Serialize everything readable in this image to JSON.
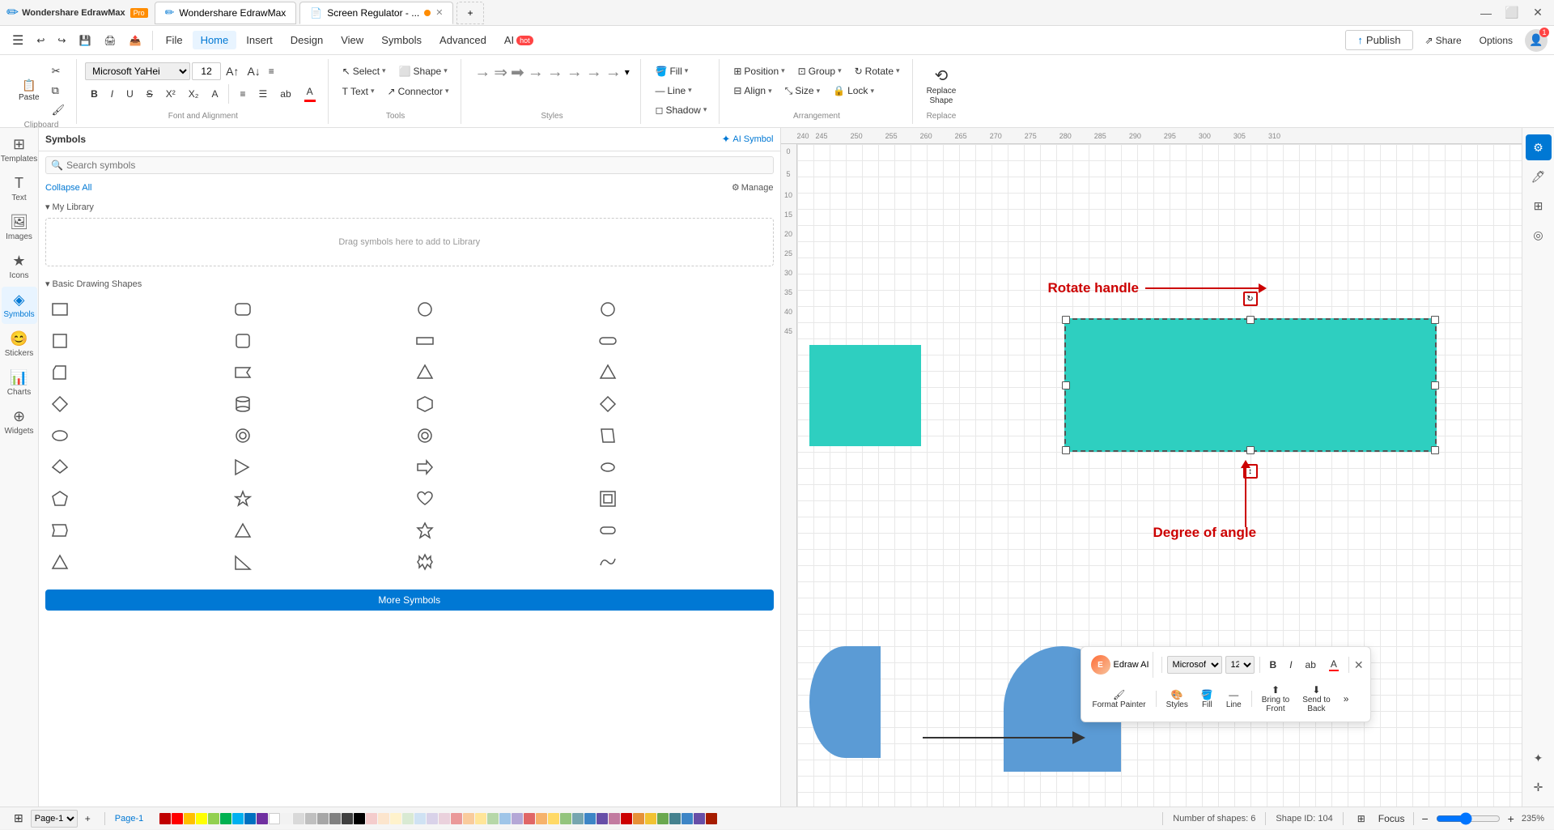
{
  "app": {
    "name": "Wondershare EdrawMax",
    "badge": "Pro"
  },
  "titlebar": {
    "tabs": [
      {
        "label": "Wondershare EdrawMax",
        "active": false
      },
      {
        "label": "Screen Regulator - ...",
        "active": true,
        "dot": true
      }
    ],
    "new_tab": "+",
    "win_controls": [
      "—",
      "⬜",
      "✕"
    ]
  },
  "menubar": {
    "items": [
      {
        "label": "File",
        "id": "file"
      },
      {
        "label": "Home",
        "id": "home",
        "active": true
      },
      {
        "label": "Insert",
        "id": "insert"
      },
      {
        "label": "Design",
        "id": "design"
      },
      {
        "label": "View",
        "id": "view"
      },
      {
        "label": "Symbols",
        "id": "symbols"
      },
      {
        "label": "Advanced",
        "id": "advanced"
      },
      {
        "label": "AI",
        "id": "ai",
        "badge": "hot"
      }
    ],
    "right": {
      "publish": "Publish",
      "share": "Share",
      "options": "Options",
      "notification_count": "1"
    }
  },
  "toolbar": {
    "clipboard": {
      "label": "Clipboard",
      "buttons": [
        "Paste",
        "Cut",
        "Copy",
        "Format Painter"
      ]
    },
    "font": {
      "label": "Font and Alignment",
      "font_name": "Microsoft YaHei",
      "font_size": "12",
      "buttons": [
        "B",
        "I",
        "U",
        "S",
        "X²",
        "X₂",
        "A",
        "≡",
        "☰",
        "ab",
        "A"
      ]
    },
    "tools": {
      "label": "Tools",
      "select": "Select",
      "select_arrow": "▾",
      "shape": "Shape",
      "shape_arrow": "▾",
      "text": "Text",
      "text_arrow": "▾",
      "connector": "Connector",
      "connector_arrow": "▾"
    },
    "styles": {
      "label": "Styles"
    },
    "fill": {
      "fill": "Fill",
      "line": "Line",
      "shadow": "Shadow"
    },
    "position": {
      "position": "Position",
      "group": "Group",
      "rotate": "Rotate",
      "align": "Align",
      "size": "Size",
      "lock": "Lock",
      "label": "Arrangement"
    },
    "replace": {
      "label": "Replace",
      "replace_shape": "Replace\nShape"
    }
  },
  "left_sidebar": {
    "items": [
      {
        "id": "templates",
        "icon": "⊞",
        "label": "Templates"
      },
      {
        "id": "text",
        "icon": "T",
        "label": "Text"
      },
      {
        "id": "images",
        "icon": "🖼",
        "label": "Images"
      },
      {
        "id": "icons",
        "icon": "★",
        "label": "Icons"
      },
      {
        "id": "symbols",
        "icon": "◈",
        "label": "Symbols",
        "active": true
      },
      {
        "id": "stickers",
        "icon": "😊",
        "label": "Stickers"
      },
      {
        "id": "charts",
        "icon": "📊",
        "label": "Charts"
      },
      {
        "id": "widgets",
        "icon": "⊕",
        "label": "Widgets"
      }
    ]
  },
  "symbols_panel": {
    "title": "Symbols",
    "ai_symbol_label": "AI Symbol",
    "search_placeholder": "Search symbols",
    "collapse_all": "Collapse All",
    "manage": "Manage",
    "my_library": "My Library",
    "drag_hint": "Drag symbols here to add to Library",
    "basic_drawing_shapes": "Basic Drawing Shapes",
    "more_symbols": "More Symbols"
  },
  "canvas": {
    "annotations": {
      "rotate_handle": "Rotate handle",
      "degree_of_angle": "Degree of angle"
    },
    "shapes": [
      {
        "type": "teal_rect_selected",
        "label": "Selected teal rectangle"
      },
      {
        "type": "teal_rect_left",
        "label": "Left teal rectangle"
      },
      {
        "type": "blue_shape_left",
        "label": "Blue half circle left"
      },
      {
        "type": "blue_shape_mid",
        "label": "Blue dome mid"
      }
    ]
  },
  "floating_toolbar": {
    "edraw_ai_label": "Edraw AI",
    "font_name": "Microsof",
    "font_size": "12",
    "buttons": {
      "bold": "B",
      "italic": "I",
      "underline": "ab",
      "font_color": "A",
      "format_painter": "Format Painter",
      "styles": "Styles",
      "fill": "Fill",
      "line": "Line",
      "bring_to_front": "Bring to\nFront",
      "send_to_back": "Send to\nBack"
    }
  },
  "right_panel": {
    "buttons": [
      "⚙",
      "🖊",
      "⊞",
      "◎"
    ]
  },
  "statusbar": {
    "page": "Page-1",
    "page_label": "Page-1",
    "num_shapes": "Number of shapes: 6",
    "shape_id": "Shape ID: 104",
    "focus": "Focus",
    "zoom_percent": "235%",
    "colors": [
      "#c00000",
      "#ff0000",
      "#ffc000",
      "#ffff00",
      "#92d050",
      "#00b050",
      "#00b0f0",
      "#0070c0",
      "#7030a0",
      "#ffffff",
      "#f2f2f2",
      "#d9d9d9",
      "#bfbfbf",
      "#a6a6a6",
      "#808080",
      "#404040",
      "#000000",
      "#f4cccc",
      "#fce5cd",
      "#fff2cc",
      "#d9ead3",
      "#d0e4f7",
      "#cfe2f3",
      "#d9d2e9",
      "#ead1dc",
      "#ea9999",
      "#f9cb9c",
      "#ffe599",
      "#b6d7a8",
      "#9fc5e8",
      "#9fc5e8",
      "#b4a7d6",
      "#ea9999",
      "#e06666",
      "#f6b26b",
      "#ffd966",
      "#93c47d",
      "#76a5af",
      "#76a5af",
      "#8e7cc3",
      "#c27ba0",
      "#cc0000",
      "#e69138",
      "#f1c232",
      "#6aa84f",
      "#45818e",
      "#3d85c6",
      "#674ea7",
      "#a61c00"
    ]
  }
}
